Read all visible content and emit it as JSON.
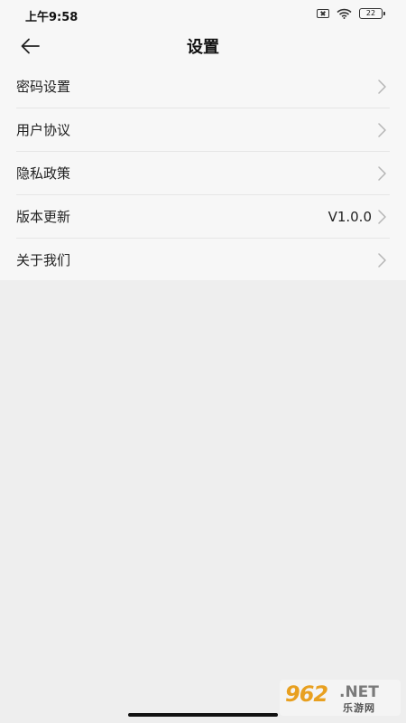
{
  "status_bar": {
    "time": "上午9:58",
    "battery_level": "22",
    "icons": [
      "sim-disabled-icon",
      "wifi-icon",
      "battery-icon"
    ]
  },
  "header": {
    "title": "设置",
    "back_icon": "back-arrow-icon"
  },
  "menu": {
    "items": [
      {
        "label": "密码设置",
        "value": ""
      },
      {
        "label": "用户协议",
        "value": ""
      },
      {
        "label": "隐私政策",
        "value": ""
      },
      {
        "label": "版本更新",
        "value": "V1.0.0"
      },
      {
        "label": "关于我们",
        "value": ""
      }
    ]
  },
  "watermark": {
    "main": "962",
    "net": ".NET",
    "sub": "乐游网"
  },
  "colors": {
    "top_background": "#f7f7f7",
    "page_background": "#eeeeee",
    "divider": "#e6e6e6",
    "chevron": "#b5b5b5",
    "watermark_accent": "#e8a020"
  }
}
